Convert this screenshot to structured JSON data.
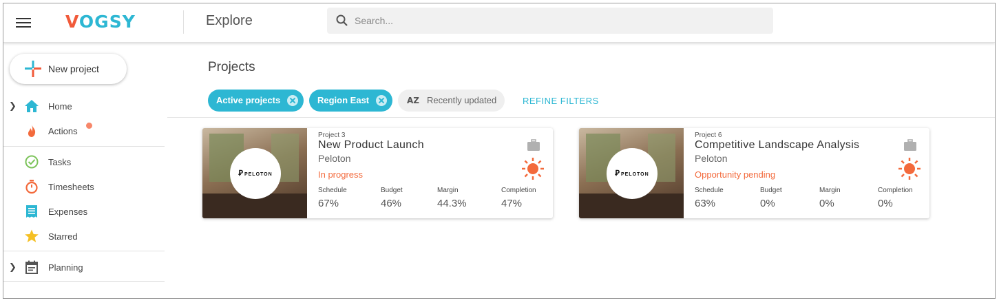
{
  "app": {
    "logo": {
      "first": "V",
      "rest": "OGSY"
    },
    "section": "Explore"
  },
  "search": {
    "placeholder": "Search...",
    "value": ""
  },
  "sidebar": {
    "new_project_label": "New project",
    "items": [
      {
        "label": "Home",
        "icon": "home-icon",
        "color": "#2db7d3"
      },
      {
        "label": "Actions",
        "icon": "flame-icon",
        "color": "#f36a3c"
      },
      {
        "label": "Tasks",
        "icon": "check-circle-icon",
        "color": "#7cc35a"
      },
      {
        "label": "Timesheets",
        "icon": "stopwatch-icon",
        "color": "#f36a3c"
      },
      {
        "label": "Expenses",
        "icon": "receipt-icon",
        "color": "#2db7d3"
      },
      {
        "label": "Starred",
        "icon": "star-icon",
        "color": "#f5c024"
      },
      {
        "label": "Planning",
        "icon": "calendar-icon",
        "color": "#555555"
      }
    ]
  },
  "main": {
    "title": "Projects",
    "filters": [
      {
        "label": "Active projects"
      },
      {
        "label": "Region East"
      }
    ],
    "sort": {
      "icon": "sort-az-icon",
      "icon_text": "AZ",
      "label": "Recently updated"
    },
    "refine_label": "REFINE FILTERS",
    "metric_labels": [
      "Schedule",
      "Budget",
      "Margin",
      "Completion"
    ],
    "projects": [
      {
        "number": "Project 3",
        "name": "New Product Launch",
        "client": "Peloton",
        "status": "In progress",
        "logo_text": "PELOTON",
        "metrics": [
          "67%",
          "46%",
          "44.3%",
          "47%"
        ]
      },
      {
        "number": "Project 6",
        "name": "Competitive Landscape Analysis",
        "client": "Peloton",
        "status": "Opportunity pending",
        "logo_text": "PELOTON",
        "metrics": [
          "63%",
          "0%",
          "0%",
          "0%"
        ]
      }
    ]
  },
  "colors": {
    "accent": "#2db7d3",
    "brand_orange": "#f15a3a",
    "status": "#f36a3c"
  }
}
